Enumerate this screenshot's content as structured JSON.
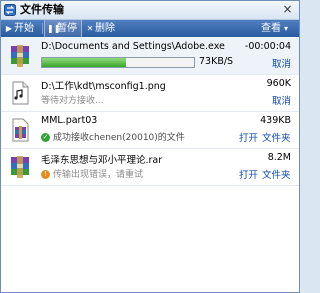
{
  "window": {
    "title": "文件传输",
    "close_glyph": "×"
  },
  "toolbar": {
    "start_label": "开始",
    "pause_label": "暂停",
    "delete_label": "删除",
    "view_label": "查看"
  },
  "transfers": [
    {
      "name": "D:\\Documents and Settings\\Adobe.exe",
      "size": "-00:00:04",
      "progress": 0.55,
      "speed": "73KB/S",
      "cancel": "取消",
      "icon": "winrar-archive-icon"
    },
    {
      "name": "D:\\工作\\kdt\\msconfig1.png",
      "size": "960K",
      "status": "等待对方接收...",
      "cancel": "取消",
      "icon": "image-file-icon"
    },
    {
      "name": "MML.part03",
      "size": "439KB",
      "status": "成功接收chenen(20010)的文件",
      "open": "打开",
      "folder": "文件夹",
      "icon": "winrar-archive-icon"
    },
    {
      "name": "毛泽东思想与邓小平理论.rar",
      "size": "8.2M",
      "status": "传输出现错误，请重试",
      "open": "打开",
      "folder": "文件夹",
      "icon": "winrar-archive-icon"
    }
  ],
  "colors": {
    "toolbar": "#2a5b9e",
    "link": "#0f49b5",
    "progress": "#3aa52a",
    "error": "#e58a1f",
    "ok": "#2fa62f"
  }
}
